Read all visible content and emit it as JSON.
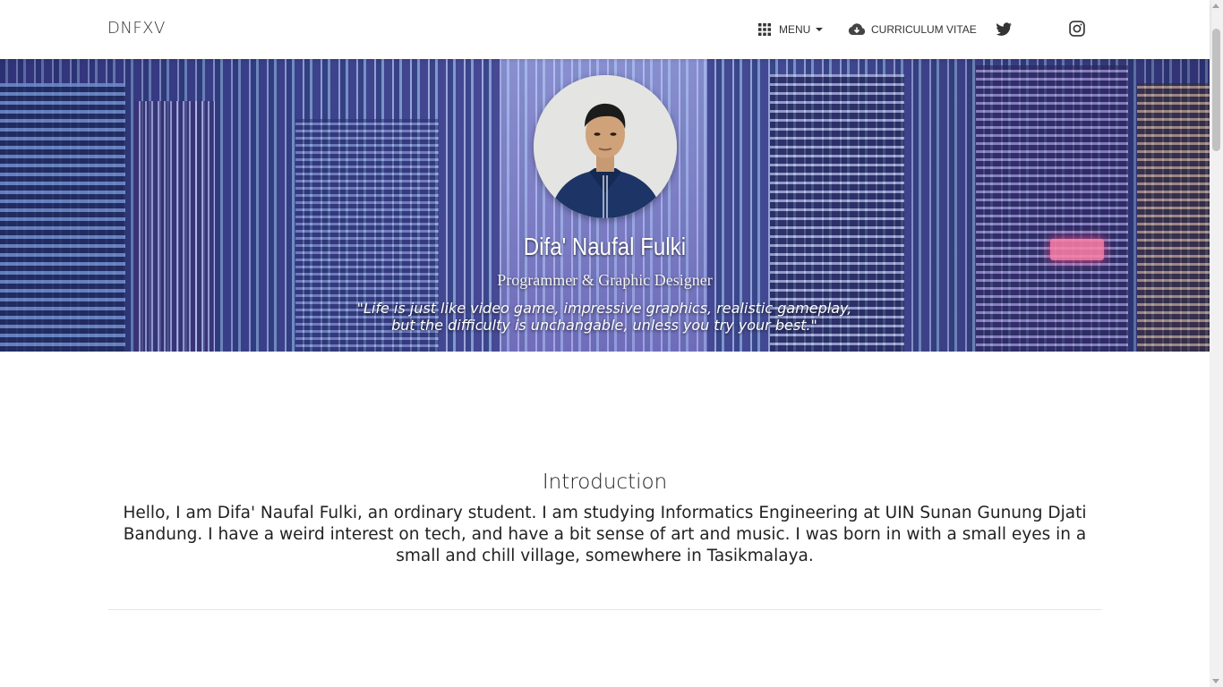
{
  "navbar": {
    "brand": "DNFXV",
    "menu_label": "MENU",
    "cv_label": "CURRICULUM VITAE",
    "menu_icon": "apps-grid-icon",
    "cv_icon": "cloud-download-icon",
    "twitter_icon": "twitter-icon",
    "instagram_icon": "instagram-icon"
  },
  "hero": {
    "name": "Difa' Naufal Fulki",
    "role": "Programmer & Graphic Designer",
    "quote": "\"Life is just like video game, impressive graphics, realistic gameplay, but the difficulty is unchangable, unless you try your best.\""
  },
  "intro": {
    "title": "Introduction",
    "text": "Hello, I am Difa' Naufal Fulki, an ordinary student. I am studying Informatics Engineering at UIN Sunan Gunung Djati Bandung. I have a weird interest on tech, and have a bit sense of art and music. I was born in with a small eyes in a small and chill village, somewhere in Tasikmalaya."
  },
  "colors": {
    "navbar_bg": "#ffffff",
    "text": "#222222",
    "hero_tint": "#3d4a8f"
  }
}
